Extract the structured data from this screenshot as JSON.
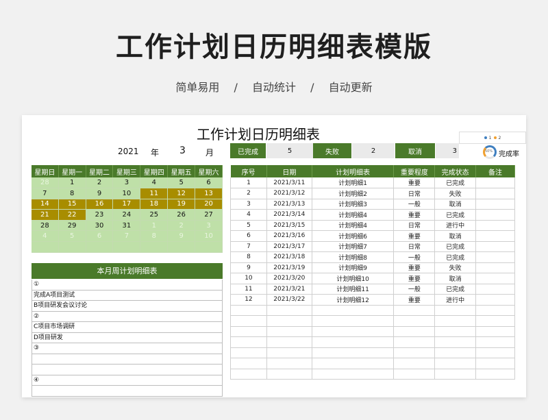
{
  "hero": {
    "title": "工作计划日历明细表模版",
    "tags": [
      "简单易用",
      "/",
      "自动统计",
      "/",
      "自动更新"
    ]
  },
  "sheet": {
    "title": "工作计划日历明细表",
    "year": "2021",
    "year_label": "年",
    "month": "3",
    "month_label": "月",
    "stats": [
      {
        "label": "已完成",
        "value": "5"
      },
      {
        "label": "失败",
        "value": "2"
      },
      {
        "label": "取消",
        "value": "3"
      }
    ],
    "ring_text": "50%",
    "done_rate_label": "完成率",
    "legend": [
      "1",
      "2"
    ]
  },
  "calendar": {
    "headers": [
      "星期日",
      "星期一",
      "星期二",
      "星期三",
      "星期四",
      "星期五",
      "星期六"
    ],
    "rows": [
      [
        [
          "28",
          "o"
        ],
        [
          "1",
          "n"
        ],
        [
          "2",
          "n"
        ],
        [
          "3",
          "n"
        ],
        [
          "4",
          "n"
        ],
        [
          "5",
          "n"
        ],
        [
          "6",
          "n"
        ]
      ],
      [
        [
          "7",
          "n"
        ],
        [
          "8",
          "n"
        ],
        [
          "9",
          "n"
        ],
        [
          "10",
          "n"
        ],
        [
          "11",
          "h"
        ],
        [
          "12",
          "h"
        ],
        [
          "13",
          "h"
        ]
      ],
      [
        [
          "14",
          "h"
        ],
        [
          "15",
          "h"
        ],
        [
          "16",
          "h"
        ],
        [
          "17",
          "h"
        ],
        [
          "18",
          "h"
        ],
        [
          "19",
          "h"
        ],
        [
          "20",
          "h"
        ]
      ],
      [
        [
          "21",
          "h"
        ],
        [
          "22",
          "h"
        ],
        [
          "23",
          "n"
        ],
        [
          "24",
          "n"
        ],
        [
          "25",
          "n"
        ],
        [
          "26",
          "n"
        ],
        [
          "27",
          "n"
        ]
      ],
      [
        [
          "28",
          "n"
        ],
        [
          "29",
          "n"
        ],
        [
          "30",
          "n"
        ],
        [
          "31",
          "n"
        ],
        [
          "1",
          "o"
        ],
        [
          "2",
          "o"
        ],
        [
          "3",
          "o"
        ]
      ],
      [
        [
          "4",
          "o"
        ],
        [
          "5",
          "o"
        ],
        [
          "6",
          "o"
        ],
        [
          "7",
          "o"
        ],
        [
          "8",
          "o"
        ],
        [
          "9",
          "o"
        ],
        [
          "10",
          "o"
        ]
      ],
      [
        [
          "",
          "o"
        ],
        [
          "",
          "o"
        ],
        [
          "",
          "o"
        ],
        [
          "",
          "o"
        ],
        [
          "",
          "o"
        ],
        [
          "",
          "o"
        ],
        [
          "",
          "o"
        ]
      ]
    ]
  },
  "week_plan": {
    "title": "本月周计划明细表",
    "rows": [
      "①",
      "完成A项目测试",
      "B项目研发会议讨论",
      "②",
      "C项目市场调研",
      "D项目研发",
      "③",
      "",
      "",
      "④",
      ""
    ]
  },
  "plan_table": {
    "headers": [
      "序号",
      "日期",
      "计划明细表",
      "重要程度",
      "完成状态",
      "备注"
    ],
    "rows": [
      [
        "1",
        "2021/3/11",
        "计划明细1",
        "重要",
        "已完成",
        ""
      ],
      [
        "2",
        "2021/3/12",
        "计划明细2",
        "日常",
        "失败",
        ""
      ],
      [
        "3",
        "2021/3/13",
        "计划明细3",
        "一般",
        "取消",
        ""
      ],
      [
        "4",
        "2021/3/14",
        "计划明细4",
        "重要",
        "已完成",
        ""
      ],
      [
        "5",
        "2021/3/15",
        "计划明细4",
        "日常",
        "进行中",
        ""
      ],
      [
        "6",
        "2021/3/16",
        "计划明细6",
        "重要",
        "取消",
        ""
      ],
      [
        "7",
        "2021/3/17",
        "计划明细7",
        "日常",
        "已完成",
        ""
      ],
      [
        "8",
        "2021/3/18",
        "计划明细8",
        "一般",
        "已完成",
        ""
      ],
      [
        "9",
        "2021/3/19",
        "计划明细9",
        "重要",
        "失败",
        ""
      ],
      [
        "10",
        "2021/3/20",
        "计划明细10",
        "重要",
        "取消",
        ""
      ],
      [
        "11",
        "2021/3/21",
        "计划明细11",
        "一般",
        "已完成",
        ""
      ],
      [
        "12",
        "2021/3/22",
        "计划明细12",
        "重要",
        "进行中",
        ""
      ],
      [
        "",
        "",
        "",
        "",
        "",
        ""
      ],
      [
        "",
        "",
        "",
        "",
        "",
        ""
      ],
      [
        "",
        "",
        "",
        "",
        "",
        ""
      ],
      [
        "",
        "",
        "",
        "",
        "",
        ""
      ],
      [
        "",
        "",
        "",
        "",
        "",
        ""
      ],
      [
        "",
        "",
        "",
        "",
        "",
        ""
      ],
      [
        "",
        "",
        "",
        "",
        "",
        ""
      ]
    ]
  }
}
